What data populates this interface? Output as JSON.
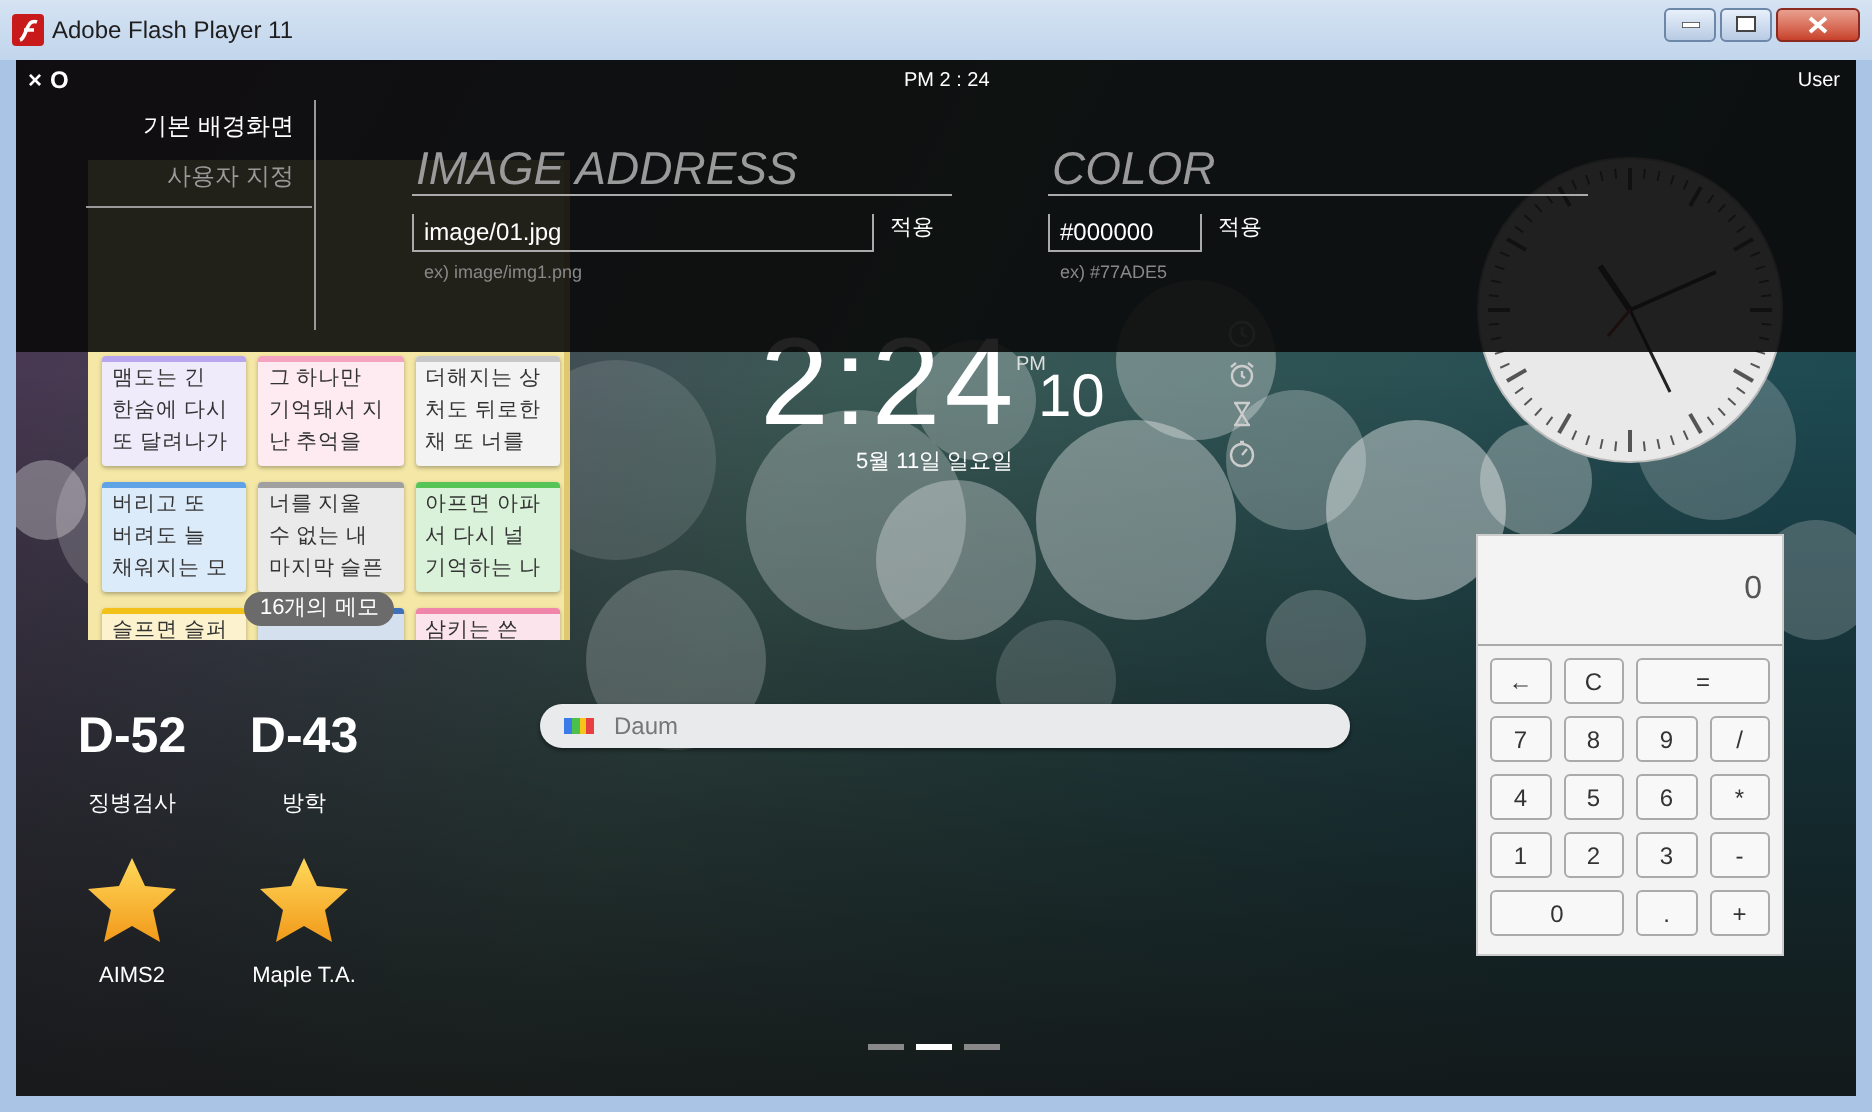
{
  "window": {
    "title": "Adobe Flash Player 11"
  },
  "top_bar": {
    "buttons": [
      "×",
      "O"
    ],
    "time": "PM 2 : 24",
    "user": "User"
  },
  "settings": {
    "menu": [
      {
        "label": "기본 배경화면",
        "selected": true
      },
      {
        "label": "사용자 지정",
        "selected": false
      }
    ],
    "sections": [
      {
        "heading": "IMAGE ADDRESS",
        "value": "image/01.jpg",
        "apply": "적용",
        "hint": "ex) image/img1.png"
      },
      {
        "heading": "COLOR",
        "value": "#000000",
        "apply": "적용",
        "hint": "ex) #77ADE5"
      }
    ]
  },
  "memo": {
    "notes": [
      {
        "color": "#b9a6ef",
        "lines": [
          "맴도는 긴",
          "한숨에 다시",
          "또 달려나가"
        ]
      },
      {
        "color": "#f4a3c0",
        "lines": [
          "그 하나만",
          "기억돼서 지",
          "난 추억을"
        ]
      },
      {
        "color": "#c8c8c8",
        "lines": [
          "더해지는 상",
          "처도 뒤로한",
          "채 또 너를"
        ]
      },
      {
        "color": "#5fa3e6",
        "lines": [
          "버리고 또",
          "버려도 늘",
          "채워지는 모"
        ]
      },
      {
        "color": "#a0a0a0",
        "lines": [
          "너를 지울",
          "수 없는 내",
          "마지막 슬픈"
        ]
      },
      {
        "color": "#56c456",
        "lines": [
          "아프면 아파",
          "서 다시 널",
          "기억하는 나"
        ]
      },
      {
        "color": "#f2c21a",
        "lines": [
          "슬프면 슬퍼"
        ]
      },
      {
        "color": "#3f70b8"
      },
      {
        "color": "#ef86aa",
        "lines": [
          "삼키는 쓴"
        ]
      }
    ],
    "count": "16개의 메모"
  },
  "clock": {
    "time": "2:24",
    "ampm": "PM",
    "seconds": "10",
    "date": "5월 11일 일요일"
  },
  "search": {
    "placeholder": "Daum"
  },
  "countdowns": [
    {
      "days": "D-52",
      "label": "징병검사"
    },
    {
      "days": "D-43",
      "label": "방학"
    }
  ],
  "shortcuts": [
    {
      "label": "AIMS2"
    },
    {
      "label": "Maple T.A."
    }
  ],
  "calculator": {
    "display": "0",
    "keys": [
      {
        "label": "←",
        "wide": false
      },
      {
        "label": "C",
        "wide": false
      },
      {
        "label": "=",
        "wide": true
      },
      {
        "label": "7",
        "wide": false
      },
      {
        "label": "8",
        "wide": false
      },
      {
        "label": "9",
        "wide": false
      },
      {
        "label": "/",
        "wide": false
      },
      {
        "label": "4",
        "wide": false
      },
      {
        "label": "5",
        "wide": false
      },
      {
        "label": "6",
        "wide": false
      },
      {
        "label": "*",
        "wide": false
      },
      {
        "label": "1",
        "wide": false
      },
      {
        "label": "2",
        "wide": false
      },
      {
        "label": "3",
        "wide": false
      },
      {
        "label": "-",
        "wide": false
      },
      {
        "label": "0",
        "wide": true
      },
      {
        "label": ".",
        "wide": false
      },
      {
        "label": "+",
        "wide": false
      }
    ]
  },
  "pages": [
    {
      "selected": false
    },
    {
      "selected": true
    },
    {
      "selected": false
    }
  ]
}
